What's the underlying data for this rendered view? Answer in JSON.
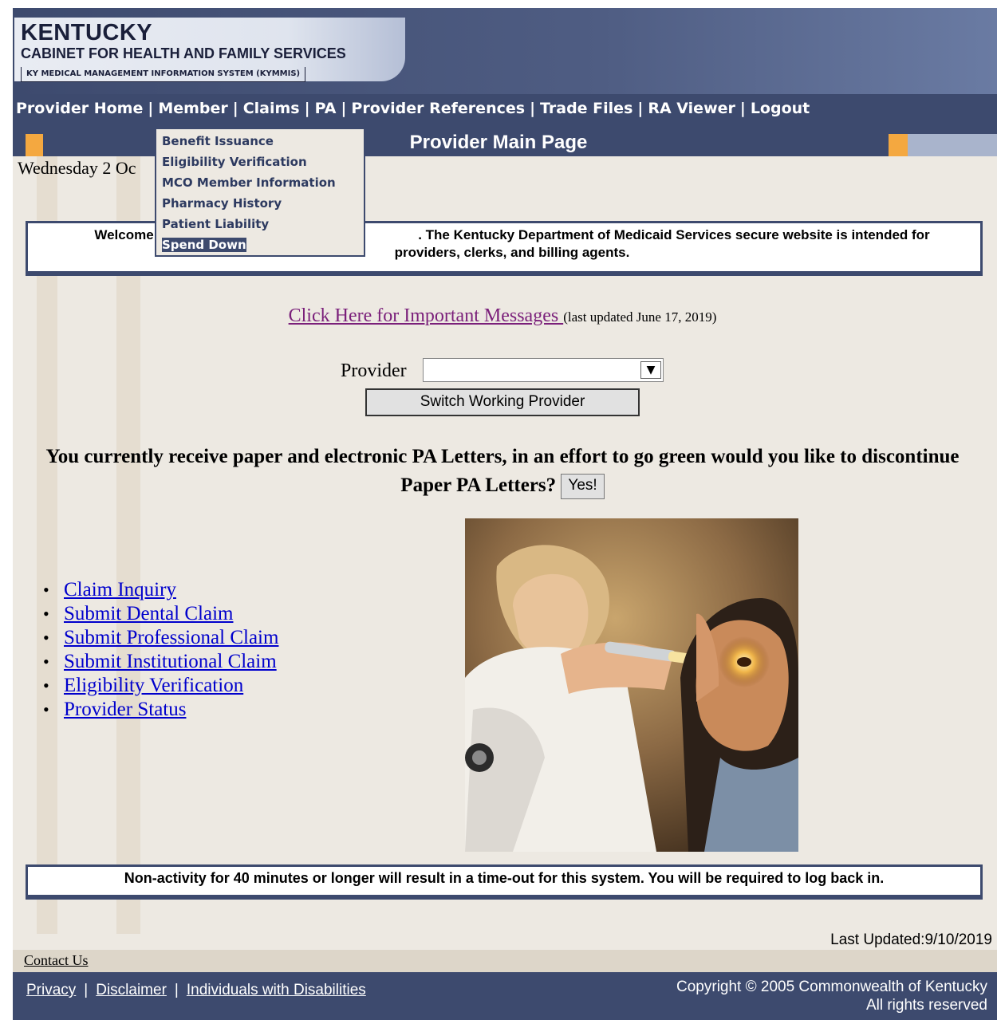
{
  "header": {
    "logo_title": "KENTUCKY",
    "logo_subtitle": "CABINET FOR HEALTH AND FAMILY SERVICES",
    "logo_system": "KY MEDICAL MANAGEMENT INFORMATION SYSTEM (KYMMIS)"
  },
  "nav": {
    "items": [
      "Provider Home",
      "Member",
      "Claims",
      "PA",
      "Provider References",
      "Trade Files",
      "RA Viewer",
      "Logout"
    ],
    "separator": "|"
  },
  "member_menu": {
    "items": [
      "Benefit Issuance",
      "Eligibility Verification",
      "MCO Member Information",
      "Pharmacy History",
      "Patient Liability",
      "Spend Down"
    ],
    "selected": "Spend Down"
  },
  "page": {
    "title": "Provider Main Page",
    "date": "Wednesday 2 Oc"
  },
  "welcome": {
    "line1_left": "Welcome to th",
    "line1_right": ". The Kentucky Department of Medicaid Services secure website is intended for",
    "line2": "providers, clerks, and billing agents."
  },
  "messages": {
    "link": "Click Here for Important Messages ",
    "updated": "(last updated June 17, 2019)"
  },
  "provider": {
    "label": "Provider",
    "selected_value": "",
    "switch_button": "Switch Working Provider"
  },
  "paperless": {
    "question_line1": "You currently receive paper and electronic PA Letters, in an effort to go green would you like to discontinue",
    "question_line2": "Paper PA Letters?",
    "yes_button": "Yes!"
  },
  "quick_links": [
    "Claim Inquiry",
    "Submit Dental Claim",
    "Submit Professional Claim",
    "Submit Institutional Claim",
    "Eligibility Verification",
    "Provider Status"
  ],
  "timeout_notice": "Non-activity for 40 minutes or longer will result in a time-out for this system. You will be required to log back in.",
  "last_updated": "Last Updated:9/10/2019",
  "footer": {
    "contact": "Contact Us",
    "links": [
      "Privacy",
      "Disclaimer",
      "Individuals with Disabilities"
    ],
    "copyright_line1": "Copyright © 2005 Commonwealth of Kentucky",
    "copyright_line2": "All rights reserved"
  },
  "colors": {
    "navy": "#3d4a6e",
    "accent_orange": "#f4a840",
    "content_bg": "#ede9e2",
    "link_blue": "#0000cc",
    "link_visited": "#7a1f7a"
  },
  "photo": {
    "icon": "doctor-examining-child-eye-photo"
  }
}
